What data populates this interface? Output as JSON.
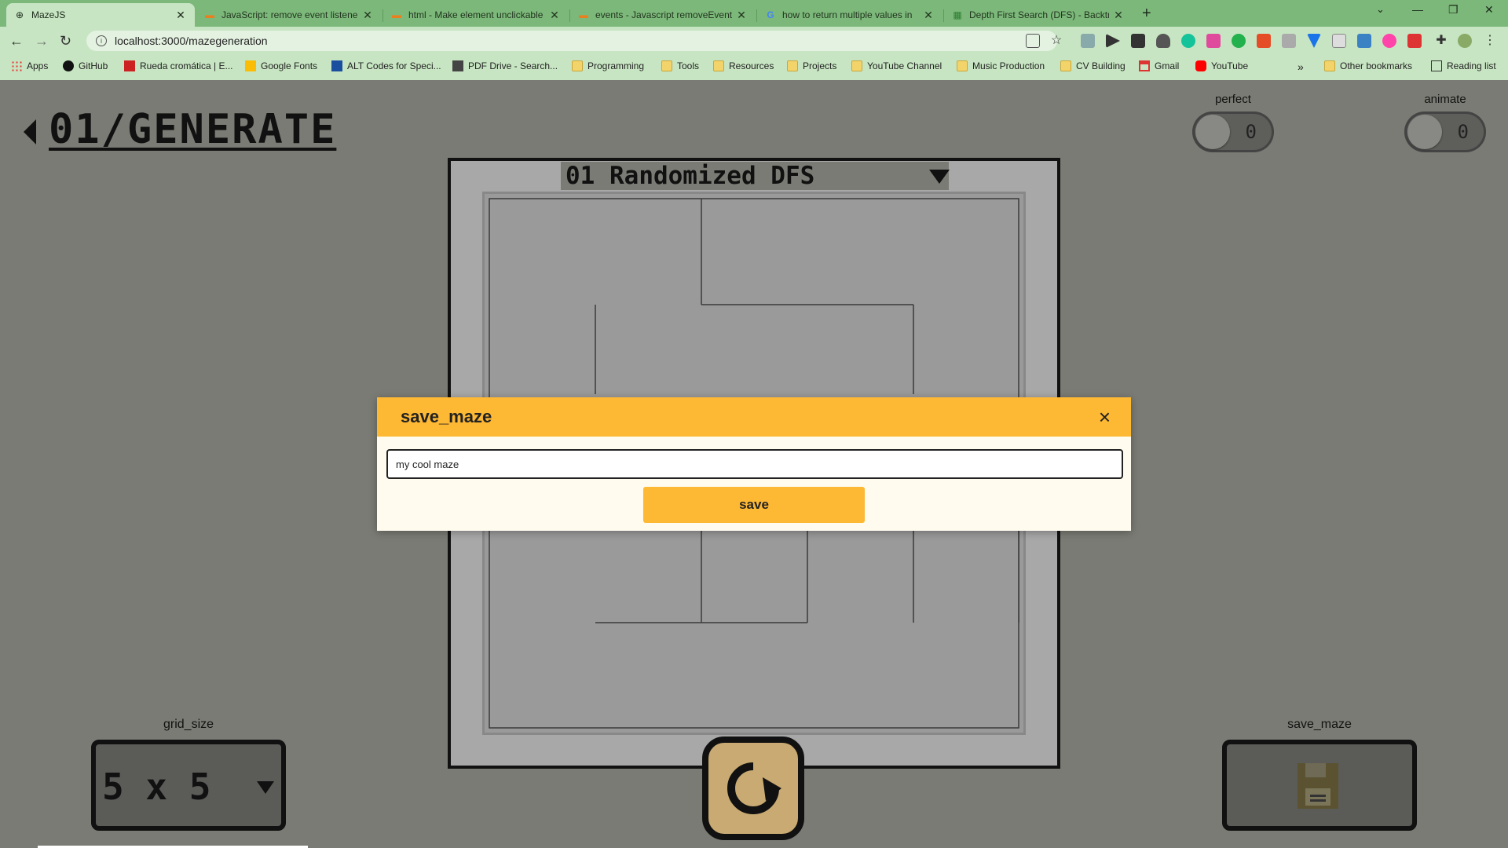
{
  "browser": {
    "tabs": [
      {
        "title": "MazeJS",
        "active": true
      },
      {
        "title": "JavaScript: remove event listener",
        "active": false
      },
      {
        "title": "html - Make element unclickable",
        "active": false
      },
      {
        "title": "events - Javascript removeEventL",
        "active": false
      },
      {
        "title": "how to return multiple values in",
        "active": false
      },
      {
        "title": "Depth First Search (DFS) - Backtr",
        "active": false
      }
    ],
    "url": "localhost:3000/mazegeneration",
    "bookmarks": [
      "Apps",
      "GitHub",
      "Rueda cromática | E...",
      "Google Fonts",
      "ALT Codes for Speci...",
      "PDF Drive - Search...",
      "Programming",
      "Tools",
      "Resources",
      "Projects",
      "YouTube Channel",
      "Music Production",
      "CV Building",
      "Gmail",
      "YouTube"
    ],
    "other_bookmarks": "Other bookmarks",
    "reading_list": "Reading list",
    "overflow": "»"
  },
  "page": {
    "title": "01/GENERATE",
    "toggles": {
      "perfect": {
        "label": "perfect",
        "value": "0"
      },
      "animate": {
        "label": "animate",
        "value": "0"
      }
    },
    "algorithm": "01 Randomized DFS",
    "grid_size": {
      "label": "grid_size",
      "value": "5 x 5"
    },
    "save_maze": {
      "label": "save_maze"
    }
  },
  "modal": {
    "title": "save_maze",
    "close": "×",
    "input_value": "my cool maze",
    "save_label": "save"
  },
  "colors": {
    "page_bg": "#7b7b75",
    "modal_accent": "#fdb834",
    "tabbar": "#7cb87a",
    "toolbar": "#c7e5c2"
  }
}
